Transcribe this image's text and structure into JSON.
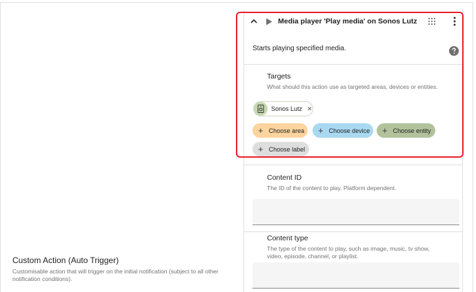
{
  "left": {
    "title": "Custom Action (Auto Trigger)",
    "description": "Customisable action that will trigger on the initial notification (subject to all other notification conditions)."
  },
  "action": {
    "title": "Media player 'Play media' on Sonos Lutz",
    "description": "Starts playing specified media."
  },
  "targets": {
    "label": "Targets",
    "help": "What should this action use as targeted areas, devices or entities.",
    "selected_device": "Sonos Lutz",
    "remove_glyph": "✕",
    "plus_glyph": "+",
    "choose_area": "Choose area",
    "choose_device": "Choose device",
    "choose_entity": "Choose entity",
    "choose_label": "Choose label"
  },
  "fields": [
    {
      "label": "Content ID",
      "help": "The ID of the content to play. Platform dependent.",
      "value": ""
    },
    {
      "label": "Content type",
      "help": "The type of the content to play, such as image, music, tv show, video, episode, channel, or playlist.",
      "value": ""
    }
  ],
  "colors": {
    "highlight": "#e8202a",
    "area_chip": "#fcd49e",
    "device_chip": "#a9d8f1",
    "entity_chip": "#b2c39c",
    "label_chip": "#dedede"
  }
}
